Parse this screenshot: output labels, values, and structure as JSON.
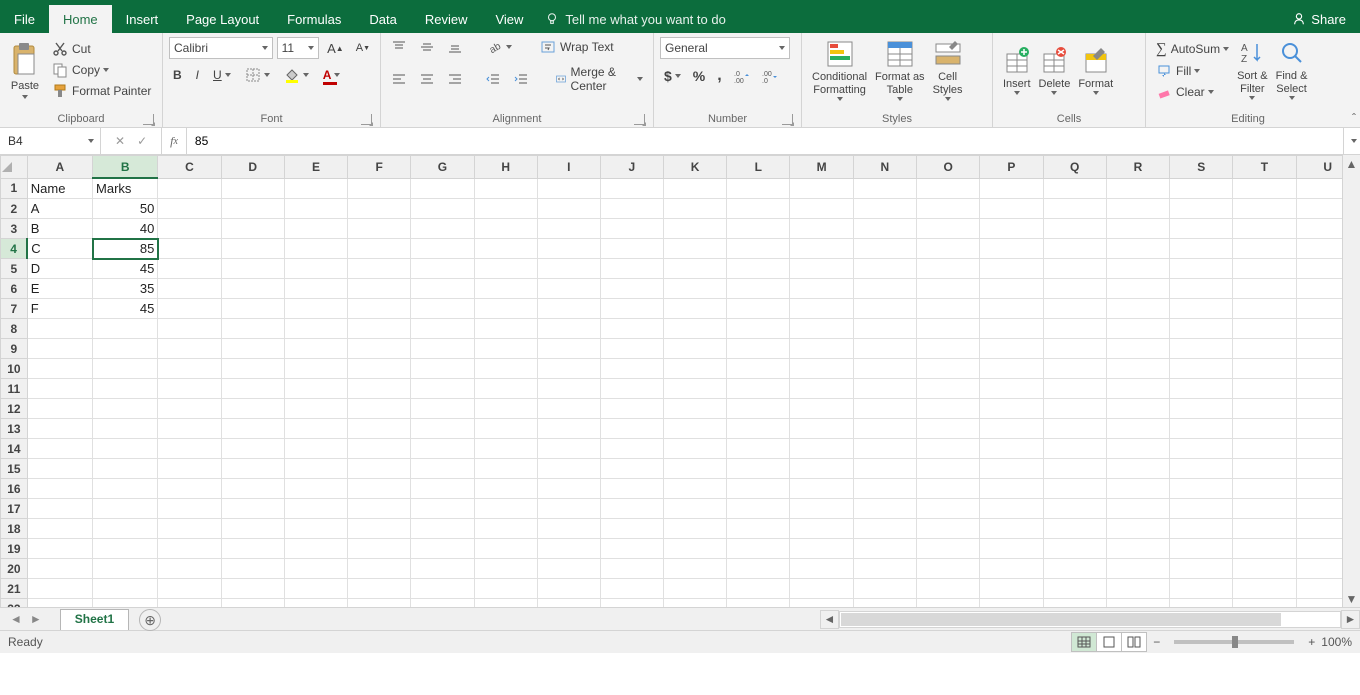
{
  "tabs": {
    "file": "File",
    "home": "Home",
    "insert": "Insert",
    "pagelayout": "Page Layout",
    "formulas": "Formulas",
    "data": "Data",
    "review": "Review",
    "view": "View"
  },
  "tellme": "Tell me what you want to do",
  "share": "Share",
  "clipboard": {
    "title": "Clipboard",
    "paste": "Paste",
    "cut": "Cut",
    "copy": "Copy",
    "fmtpaint": "Format Painter"
  },
  "font": {
    "title": "Font",
    "name": "Calibri",
    "size": "11"
  },
  "alignment": {
    "title": "Alignment",
    "wrap": "Wrap Text",
    "merge": "Merge & Center"
  },
  "number": {
    "title": "Number",
    "format": "General"
  },
  "styles": {
    "title": "Styles",
    "cond": "Conditional\nFormatting",
    "table": "Format as\nTable",
    "cell": "Cell\nStyles"
  },
  "cells": {
    "title": "Cells",
    "insert": "Insert",
    "delete": "Delete",
    "format": "Format"
  },
  "editing": {
    "title": "Editing",
    "autosum": "AutoSum",
    "fill": "Fill",
    "clear": "Clear",
    "sort": "Sort &\nFilter",
    "find": "Find &\nSelect"
  },
  "namebox": "B4",
  "formula": "85",
  "columns": [
    "A",
    "B",
    "C",
    "D",
    "E",
    "F",
    "G",
    "H",
    "I",
    "J",
    "K",
    "L",
    "M",
    "N",
    "O",
    "P",
    "Q",
    "R",
    "S",
    "T",
    "U"
  ],
  "rowcount": 23,
  "selected": {
    "row": 4,
    "col": "B"
  },
  "cells_data": {
    "1": {
      "A": "Name",
      "B": "Marks"
    },
    "2": {
      "A": "A",
      "B": "50"
    },
    "3": {
      "A": "B",
      "B": "40"
    },
    "4": {
      "A": "C",
      "B": "85"
    },
    "5": {
      "A": "D",
      "B": "45"
    },
    "6": {
      "A": "E",
      "B": "35"
    },
    "7": {
      "A": "F",
      "B": "45"
    }
  },
  "sheet": "Sheet1",
  "status": "Ready",
  "zoom": "100%"
}
